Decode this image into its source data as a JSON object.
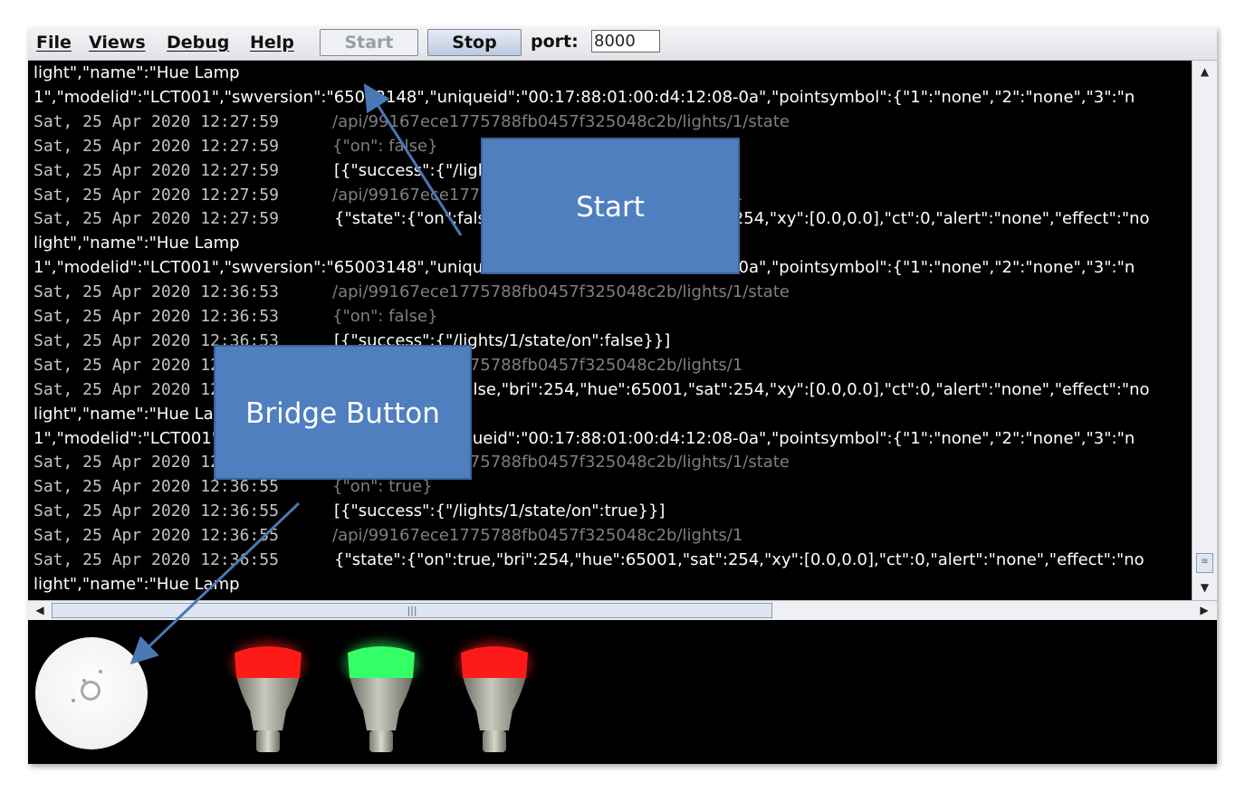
{
  "menu": {
    "items": [
      {
        "label": "File"
      },
      {
        "label": "Views"
      },
      {
        "label": "Debug"
      },
      {
        "label": "Help"
      }
    ]
  },
  "toolbar": {
    "start_label": "Start",
    "stop_label": "Stop",
    "port_label": "port:",
    "port_value": "8000"
  },
  "log": {
    "lines": [
      {
        "kind": "full",
        "text": "light\",\"name\":\"Hue Lamp"
      },
      {
        "kind": "full",
        "text": "1\",\"modelid\":\"LCT001\",\"swversion\":\"65003148\",\"uniqueid\":\"00:17:88:01:00:d4:12:08-0a\",\"pointsymbol\":{\"1\":\"none\",\"2\":\"none\",\"3\":\"n"
      },
      {
        "kind": "gray",
        "ts": "Sat, 25 Apr 2020 12:27:59",
        "text": "/api/99167ece1775788fb0457f325048c2b/lights/1/state"
      },
      {
        "kind": "gray",
        "ts": "Sat, 25 Apr 2020 12:27:59",
        "text": "{\"on\": false}"
      },
      {
        "kind": "white",
        "ts": "Sat, 25 Apr 2020 12:27:59",
        "text": "[{\"success\":{\"/lights/1/state/on\":false}}]"
      },
      {
        "kind": "gray",
        "ts": "Sat, 25 Apr 2020 12:27:59",
        "text": "/api/99167ece1775788fb0457f325048c2b/lights/1"
      },
      {
        "kind": "white",
        "ts": "Sat, 25 Apr 2020 12:27:59",
        "text": "{\"state\":{\"on\":false,\"bri\":254,\"hue\":65001,\"sat\":254,\"xy\":[0.0,0.0],\"ct\":0,\"alert\":\"none\",\"effect\":\"no"
      },
      {
        "kind": "full",
        "text": "light\",\"name\":\"Hue Lamp"
      },
      {
        "kind": "full",
        "text": "1\",\"modelid\":\"LCT001\",\"swversion\":\"65003148\",\"uniqueid\":\"00:17:88:01:00:d4:12:08-0a\",\"pointsymbol\":{\"1\":\"none\",\"2\":\"none\",\"3\":\"n"
      },
      {
        "kind": "gray",
        "ts": "Sat, 25 Apr 2020 12:36:53",
        "text": "/api/99167ece1775788fb0457f325048c2b/lights/1/state"
      },
      {
        "kind": "gray",
        "ts": "Sat, 25 Apr 2020 12:36:53",
        "text": "{\"on\": false}"
      },
      {
        "kind": "white",
        "ts": "Sat, 25 Apr 2020 12:36:53",
        "text": "[{\"success\":{\"/lights/1/state/on\":false}}]"
      },
      {
        "kind": "gray",
        "ts": "Sat, 25 Apr 2020 12:36:53",
        "text": "/api/99167ece1775788fb0457f325048c2b/lights/1"
      },
      {
        "kind": "white",
        "ts": "Sat, 25 Apr 2020 12:36:53",
        "text": "{\"state\":{\"on\":false,\"bri\":254,\"hue\":65001,\"sat\":254,\"xy\":[0.0,0.0],\"ct\":0,\"alert\":\"none\",\"effect\":\"no"
      },
      {
        "kind": "full",
        "text": "light\",\"name\":\"Hue Lamp"
      },
      {
        "kind": "full",
        "text": "1\",\"modelid\":\"LCT001\",\"swversion\":\"65003148\",\"uniqueid\":\"00:17:88:01:00:d4:12:08-0a\",\"pointsymbol\":{\"1\":\"none\",\"2\":\"none\",\"3\":\"n"
      },
      {
        "kind": "gray",
        "ts": "Sat, 25 Apr 2020 12:36:55",
        "text": "/api/99167ece1775788fb0457f325048c2b/lights/1/state"
      },
      {
        "kind": "gray",
        "ts": "Sat, 25 Apr 2020 12:36:55",
        "text": "{\"on\": true}"
      },
      {
        "kind": "white",
        "ts": "Sat, 25 Apr 2020 12:36:55",
        "text": "[{\"success\":{\"/lights/1/state/on\":true}}]"
      },
      {
        "kind": "gray",
        "ts": "Sat, 25 Apr 2020 12:36:55",
        "text": "/api/99167ece1775788fb0457f325048c2b/lights/1"
      },
      {
        "kind": "white",
        "ts": "Sat, 25 Apr 2020 12:36:55",
        "text": "{\"state\":{\"on\":true,\"bri\":254,\"hue\":65001,\"sat\":254,\"xy\":[0.0,0.0],\"ct\":0,\"alert\":\"none\",\"effect\":\"no"
      },
      {
        "kind": "full",
        "text": "light\",\"name\":\"Hue Lamp"
      },
      {
        "kind": "full",
        "text": "1\",\"modelid\":\"LCT001\",\"swversion\":\"65003148\",\"uniqueid\":\"00:17:88:01:00:d4:12:08-0a\",\"pointsymbol\":{\"1\":\"none\",\"2\":\"none\",\"3\":\"n"
      }
    ]
  },
  "scene": {
    "bulbs": [
      {
        "color": "#ff1a1a"
      },
      {
        "color": "#33ff66"
      },
      {
        "color": "#ff1a1a"
      }
    ]
  },
  "annotations": {
    "start_callout": "Start",
    "bridge_callout": "Bridge Button"
  },
  "colors": {
    "callout_fill": "#4f7fbe",
    "arrow": "#4a78b5"
  }
}
